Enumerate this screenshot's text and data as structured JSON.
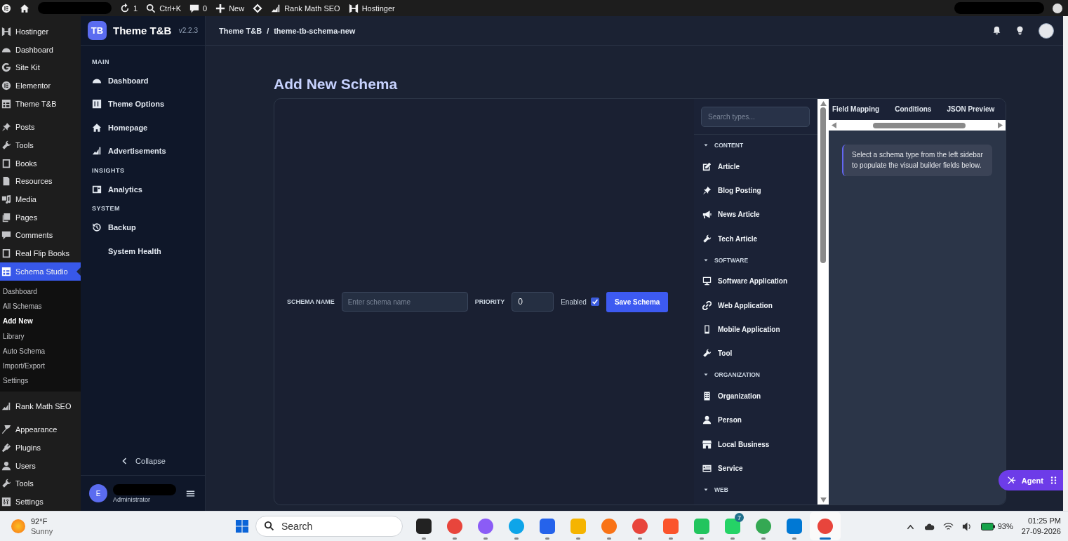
{
  "admin_bar": {
    "items": [
      {
        "label": "1"
      },
      {
        "label": "Ctrl+K"
      },
      {
        "label": "0"
      },
      {
        "label": "New"
      },
      {
        "label": "Rank Math SEO"
      },
      {
        "label": "Hostinger"
      }
    ]
  },
  "wp_menu": {
    "groups": [
      {
        "items": [
          {
            "label": "Hostinger",
            "selected": false
          },
          {
            "label": "Dashboard",
            "selected": false
          },
          {
            "label": "Site Kit",
            "selected": false
          },
          {
            "label": "Elementor",
            "selected": false
          },
          {
            "label": "Theme T&B",
            "selected": false
          }
        ]
      },
      {
        "items": [
          {
            "label": "Posts",
            "selected": false
          },
          {
            "label": "Tools",
            "selected": false
          },
          {
            "label": "Books",
            "selected": false
          },
          {
            "label": "Resources",
            "selected": false
          },
          {
            "label": "Media",
            "selected": false
          },
          {
            "label": "Pages",
            "selected": false
          },
          {
            "label": "Comments",
            "selected": false
          },
          {
            "label": "Real Flip Books",
            "selected": false
          },
          {
            "label": "Schema Studio",
            "selected": true,
            "children": [
              {
                "label": "Dashboard",
                "selected": false
              },
              {
                "label": "All Schemas",
                "selected": false
              },
              {
                "label": "Add New",
                "selected": true
              },
              {
                "label": "Library",
                "selected": false
              },
              {
                "label": "Auto Schema",
                "selected": false
              },
              {
                "label": "Import/Export",
                "selected": false
              },
              {
                "label": "Settings",
                "selected": false
              }
            ]
          }
        ]
      },
      {
        "items": [
          {
            "label": "Rank Math SEO",
            "selected": false
          }
        ]
      },
      {
        "items": [
          {
            "label": "Appearance",
            "selected": false
          },
          {
            "label": "Plugins",
            "selected": false
          },
          {
            "label": "Users",
            "selected": false
          },
          {
            "label": "Tools",
            "selected": false
          },
          {
            "label": "Settings",
            "selected": false
          }
        ]
      }
    ]
  },
  "plugin_sidebar": {
    "logo": "TB",
    "title": "Theme T&B",
    "version": "v2.2.3",
    "sections": [
      {
        "title": "MAIN",
        "items": [
          {
            "label": "Dashboard",
            "selected": false
          },
          {
            "label": "Theme Options",
            "selected": false
          },
          {
            "label": "Homepage",
            "selected": false
          },
          {
            "label": "Advertisements",
            "selected": false
          }
        ]
      },
      {
        "title": "INSIGHTS",
        "items": [
          {
            "label": "Analytics",
            "selected": false
          }
        ]
      },
      {
        "title": "SYSTEM",
        "items": [
          {
            "label": "Backup",
            "selected": false
          },
          {
            "label": "System Health",
            "selected": false
          }
        ]
      }
    ],
    "collapse": "Collapse",
    "user": {
      "initial": "E",
      "role": "Administrator"
    }
  },
  "header": {
    "breadcrumb": [
      "Theme T&B",
      "theme-tb-schema-new"
    ],
    "separator": "/"
  },
  "page_title": "Add New Schema",
  "form": {
    "name_label": "SCHEMA NAME",
    "name_placeholder": "Enter schema name",
    "priority_label": "PRIORITY",
    "priority_value": "0",
    "enabled_label": "Enabled",
    "enabled_checked": true,
    "save_button": "Save Schema"
  },
  "type_sidebar": {
    "search_placeholder": "Search types...",
    "groups": [
      {
        "title": "CONTENT",
        "expanded": true,
        "items": [
          "Article",
          "Blog Posting",
          "News Article",
          "Tech Article"
        ]
      },
      {
        "title": "SOFTWARE",
        "expanded": true,
        "items": [
          "Software Application",
          "Web Application",
          "Mobile Application",
          "Tool"
        ]
      },
      {
        "title": "ORGANIZATION",
        "expanded": true,
        "items": [
          "Organization",
          "Person",
          "Local Business",
          "Service"
        ]
      },
      {
        "title": "WEB",
        "expanded": true
      }
    ]
  },
  "builder_panel": {
    "tabs": [
      {
        "label": "Field Mapping",
        "selected": false
      },
      {
        "label": "Conditions",
        "selected": false
      },
      {
        "label": "JSON Preview",
        "selected": false
      }
    ],
    "note": "Select a schema type from the left sidebar to populate the visual builder fields below."
  },
  "agent_button": "Agent",
  "taskbar": {
    "weather": {
      "temp": "92°F",
      "condition": "Sunny"
    },
    "search_placeholder": "Search",
    "apps": [
      {
        "selected": false
      },
      {
        "selected": false
      },
      {
        "selected": false
      },
      {
        "selected": false
      },
      {
        "selected": false
      },
      {
        "selected": false
      },
      {
        "selected": false
      },
      {
        "selected": false
      },
      {
        "selected": false
      },
      {
        "selected": false
      },
      {
        "selected": false,
        "badge": "7"
      },
      {
        "selected": false
      },
      {
        "selected": false
      },
      {
        "selected": true
      }
    ],
    "battery": "93%",
    "time": "01:25 PM",
    "date": "27-09-2026"
  }
}
